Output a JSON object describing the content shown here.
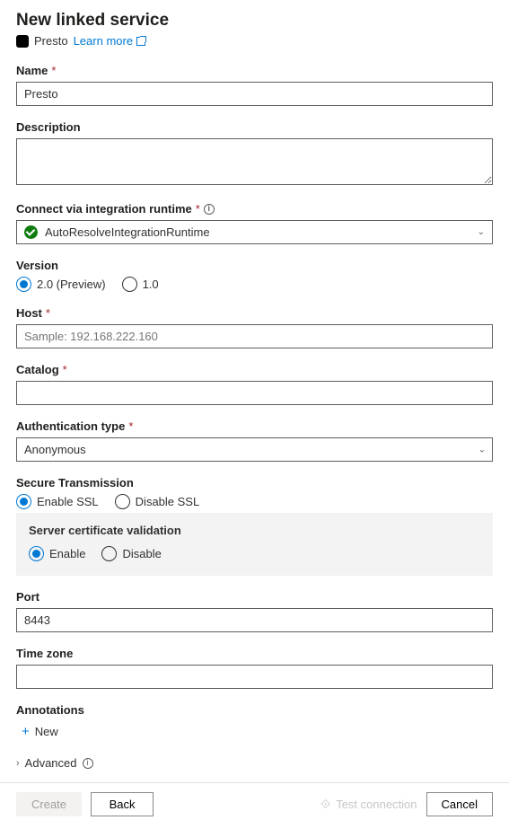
{
  "header": {
    "title": "New linked service",
    "connector": "Presto",
    "learn_more": "Learn more"
  },
  "fields": {
    "name": {
      "label": "Name",
      "value": "Presto"
    },
    "description": {
      "label": "Description",
      "value": ""
    },
    "ir": {
      "label": "Connect via integration runtime",
      "value": "AutoResolveIntegrationRuntime"
    },
    "version": {
      "label": "Version",
      "options": {
        "v20": "2.0 (Preview)",
        "v10": "1.0"
      },
      "selected": "v20"
    },
    "host": {
      "label": "Host",
      "placeholder": "Sample: 192.168.222.160",
      "value": ""
    },
    "catalog": {
      "label": "Catalog",
      "value": ""
    },
    "auth": {
      "label": "Authentication type",
      "value": "Anonymous"
    },
    "secure": {
      "label": "Secure Transmission",
      "options": {
        "enable": "Enable SSL",
        "disable": "Disable SSL"
      },
      "selected": "enable"
    },
    "server_cert": {
      "label": "Server certificate validation",
      "options": {
        "enable": "Enable",
        "disable": "Disable"
      },
      "selected": "enable"
    },
    "port": {
      "label": "Port",
      "value": "8443"
    },
    "timezone": {
      "label": "Time zone",
      "value": ""
    },
    "annotations": {
      "label": "Annotations",
      "new": "New"
    },
    "advanced": {
      "label": "Advanced"
    }
  },
  "footer": {
    "create": "Create",
    "back": "Back",
    "test": "Test connection",
    "cancel": "Cancel"
  }
}
